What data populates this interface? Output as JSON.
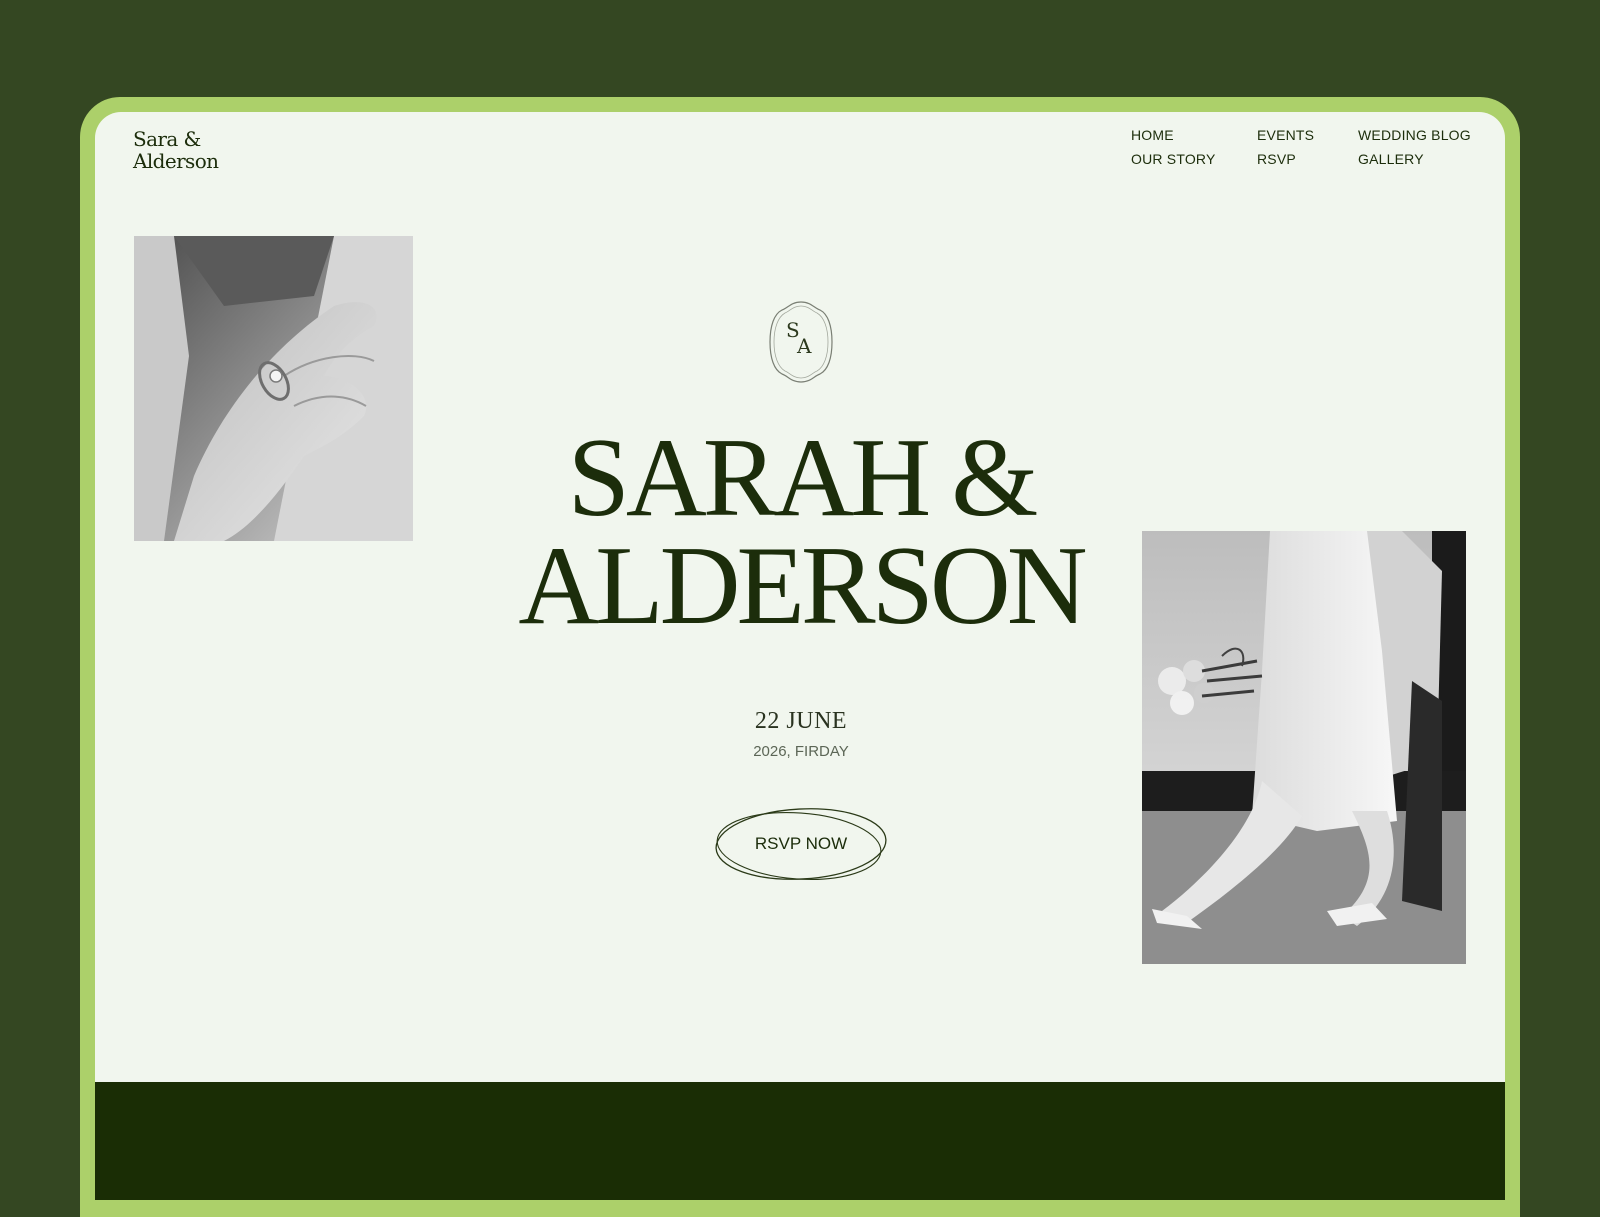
{
  "brand": {
    "line1": "Sara &",
    "line2": "Alderson"
  },
  "nav": {
    "items": [
      {
        "label": "HOME"
      },
      {
        "label": "OUR STORY"
      },
      {
        "label": "EVENTS"
      },
      {
        "label": "RSVP"
      },
      {
        "label": "WEDDING BLOG"
      },
      {
        "label": "GALLERY"
      }
    ]
  },
  "monogram": {
    "letter1": "S",
    "letter2": "A"
  },
  "hero": {
    "line1": "SARAH &",
    "line2": "ALDERSON"
  },
  "date": {
    "main": "22 JUNE",
    "sub": "2026, FIRDAY"
  },
  "cta": {
    "label": "RSVP NOW"
  },
  "colors": {
    "outer_background": "#344722",
    "frame_accent": "#acd06a",
    "page_background": "#f1f6ee",
    "text_dark_green": "#1c2d0b",
    "footer_band": "#1a2d05"
  },
  "images": [
    {
      "name": "ring-hand-photo",
      "description_icon": "photo-icon"
    },
    {
      "name": "bride-walking-photo",
      "description_icon": "photo-icon"
    }
  ]
}
